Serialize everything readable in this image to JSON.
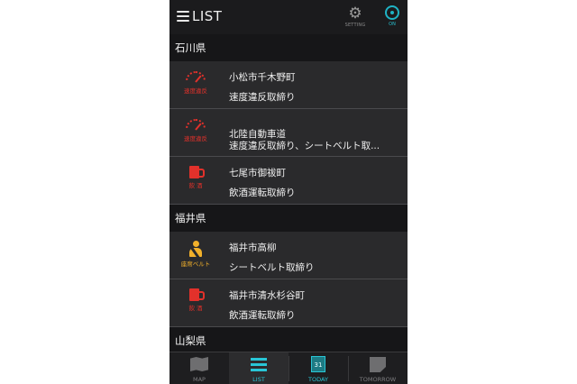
{
  "header": {
    "title": "LIST",
    "setting_label": "SETTING",
    "on_label": "ON"
  },
  "sections": [
    {
      "name": "石川県",
      "items": [
        {
          "place": "小松市千木野町",
          "kind": "速度違反取締り",
          "icon": "speedometer-icon",
          "tag": "速度違反"
        },
        {
          "place": "北陸自動車道",
          "kind": "速度違反取締り、シートベルト取...",
          "icon": "speedometer-icon",
          "tag": "速度違反"
        },
        {
          "place": "七尾市御祓町",
          "kind": "飲酒運転取締り",
          "icon": "beer-mug-icon",
          "tag": "飲 酒"
        }
      ]
    },
    {
      "name": "福井県",
      "items": [
        {
          "place": "福井市高柳",
          "kind": "シートベルト取締り",
          "icon": "seatbelt-icon",
          "tag": "座席ベルト"
        },
        {
          "place": "福井市清水杉谷町",
          "kind": "飲酒運転取締り",
          "icon": "beer-mug-icon",
          "tag": "飲 酒"
        }
      ]
    },
    {
      "name": "山梨県",
      "items": []
    }
  ],
  "tabs": [
    {
      "label": "MAP",
      "icon": "map-icon"
    },
    {
      "label": "LIST",
      "icon": "list-icon"
    },
    {
      "label": "TODAY",
      "icon": "calendar-icon",
      "calendar_day": "31"
    },
    {
      "label": "TOMORROW",
      "icon": "calendar-page-icon"
    }
  ],
  "colors": {
    "accent": "#29c6d6",
    "speed_red": "#e2312b",
    "seatbelt_yellow": "#f2b12b",
    "background": "#2a2a2c"
  }
}
